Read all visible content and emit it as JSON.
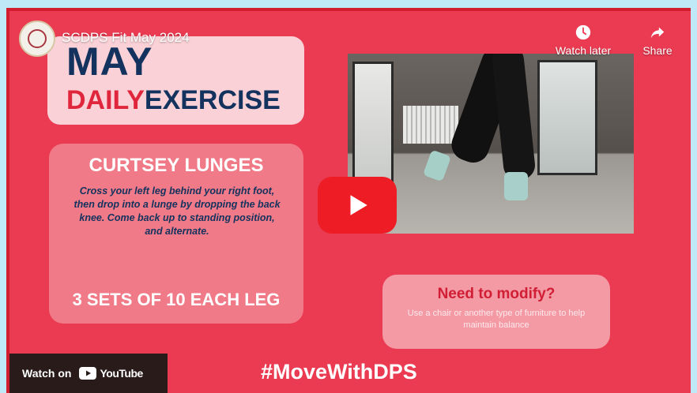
{
  "player": {
    "video_title": "SCDPS Fit May 2024",
    "watch_later_label": "Watch later",
    "share_label": "Share",
    "watch_on_label": "Watch on",
    "youtube_wordmark": "YouTube"
  },
  "thumbnail": {
    "title_line1": "MAY",
    "title_line2_word1": "DAILY",
    "title_line2_word2": "EXERCISE",
    "exercise_name": "CURTSEY LUNGES",
    "exercise_description": "Cross your left leg behind your right foot, then drop into a lunge by dropping the back knee. Come back up to standing position, and alternate.",
    "sets": "3 SETS OF 10 EACH LEG",
    "modify_title": "Need to modify?",
    "modify_description": "Use a chair or another type of furniture to help maintain balance",
    "hashtag": "#MoveWithDPS"
  },
  "colors": {
    "background": "#ea3b52",
    "navy": "#13325e",
    "play_red": "#ee1c24"
  },
  "icons": {
    "watch_later": "clock-icon",
    "share": "share-arrow-icon",
    "play": "play-icon",
    "youtube": "youtube-logo-icon"
  }
}
